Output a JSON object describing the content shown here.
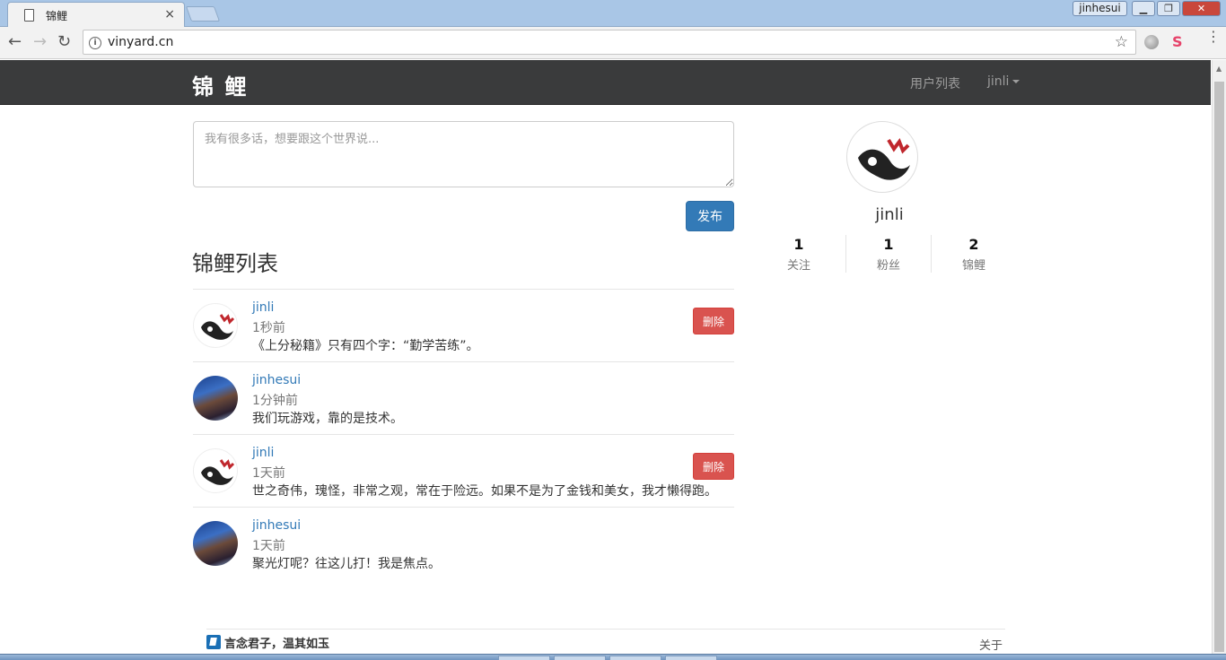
{
  "browser": {
    "tab_title": "锦鲤",
    "tab_close": "×",
    "url": "vinyard.cn",
    "profile_name": "jinhesui",
    "info_icon": "info-icon",
    "star_icon": "bookmark-star-icon"
  },
  "navbar": {
    "brand": "锦 鲤",
    "users_link": "用户列表",
    "me_link": "jinli"
  },
  "compose": {
    "placeholder": "我有很多话，想要跟这个世界说...",
    "publish_label": "发布"
  },
  "feed": {
    "title": "锦鲤列表",
    "items": [
      {
        "user": "jinli",
        "time": "1秒前",
        "text": "《上分秘籍》只有四个字：“勤学苦练”。",
        "delete_label": "删除",
        "avatar": "koi"
      },
      {
        "user": "jinhesui",
        "time": "1分钟前",
        "text": "我们玩游戏，靠的是技术。",
        "avatar": "mountain"
      },
      {
        "user": "jinli",
        "time": "1天前",
        "text": "世之奇伟，瑰怪，非常之观，常在于险远。如果不是为了金钱和美女，我才懒得跑。",
        "delete_label": "删除",
        "avatar": "koi"
      },
      {
        "user": "jinhesui",
        "time": "1天前",
        "text": "聚光灯呢？往这儿打！我是焦点。",
        "avatar": "mountain"
      }
    ]
  },
  "profile": {
    "name": "jinli",
    "stats": [
      {
        "num": "1",
        "label": "关注"
      },
      {
        "num": "1",
        "label": "粉丝"
      },
      {
        "num": "2",
        "label": "锦鲤"
      }
    ]
  },
  "footer": {
    "slogan": "言念君子，温其如玉",
    "about": "关于"
  },
  "colors": {
    "navbar_bg": "#3a3b3c",
    "primary": "#337ab7",
    "danger": "#d9534f",
    "link": "#337ab7"
  }
}
